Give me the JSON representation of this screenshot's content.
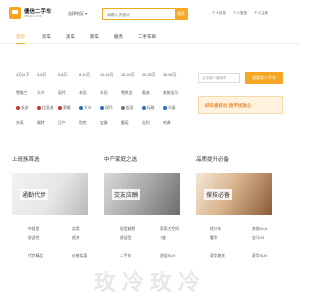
{
  "header": {
    "logo_text": "優信二手车",
    "logo_sub": "xinyu2.com",
    "city": "选择地区 ▾",
    "search_placeholder": "请输入关键词",
    "search_button": "搜索",
    "links": [
      "个人信息",
      "个人登录",
      "个人注册"
    ]
  },
  "nav": {
    "items": [
      "首页",
      "买车",
      "卖车",
      "新车",
      "服务",
      "二手车商"
    ]
  },
  "filters": {
    "prices": [
      "3万以下",
      "3-5万",
      "5-8万",
      "8-10万",
      "10-15万",
      "15-20万",
      "20-30万",
      "30-50万"
    ],
    "brand_row1": [
      "雪佛兰",
      "大众",
      "现代",
      "本田",
      "丰田",
      "雪铁龙",
      "奥迪",
      "奔驰宝马"
    ],
    "brand_row2": [
      "长安",
      "比亚迪",
      "荣威",
      "大众",
      "现代",
      "起亚",
      "标致",
      "众泰"
    ],
    "brand_row3": [
      "东风",
      "福特",
      "日产",
      "别克",
      "宝骏",
      "雷诺",
      "吉利",
      "哈弗"
    ],
    "sell_placeholder": "点击填一键卖车",
    "sell_button": "我要卖二手车",
    "banner": "好车卖好价 放手找放心"
  },
  "sections": [
    {
      "title": "上班族首选",
      "card_label": "通勤代步",
      "items": [
        "手动挡",
        "轻便实用",
        "省油",
        "舒适",
        "两厢",
        "小空间"
      ]
    },
    {
      "title": "中产家庭之选",
      "card_label": "交友应酬",
      "items": [
        "大空间",
        "家用SUV",
        "舒适车型",
        "自动车型",
        "高端",
        "大气"
      ]
    },
    {
      "title": "品质提升必备",
      "card_label": "撑技必备",
      "items": [
        "Macan",
        "宝马X5",
        "卡宴",
        "奔驰S",
        "保时捷",
        "路虎"
      ]
    }
  ],
  "grid_extra": {
    "col1": [
      "中轻型",
      "舒适性",
      "代步精品"
    ],
    "col2": [
      "实用",
      "经济",
      "价格实惠"
    ],
    "col3": [
      "轻型越野",
      "舒适型",
      "二手车"
    ],
    "col4": [
      "家用大空间",
      "7座",
      "舒适SUV"
    ],
    "col5": [
      "进口车",
      "奢华",
      "豪华跑车"
    ],
    "col6": [
      "奔驰GLA",
      "宝马X3",
      "豪华SUV"
    ]
  },
  "watermark": "玫冷玫冷",
  "colors": {
    "accent": "#f5a623",
    "banner_text": "#e8862c"
  }
}
